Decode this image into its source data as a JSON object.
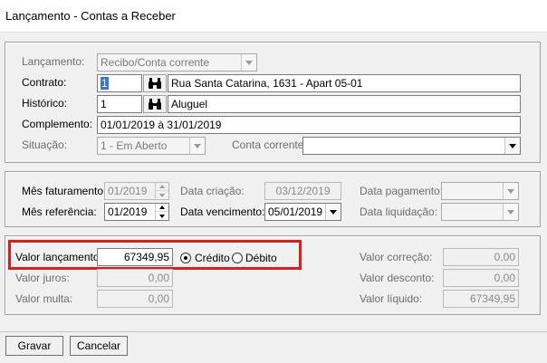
{
  "window": {
    "title": "Lançamento - Contas a Receber"
  },
  "section_main": {
    "lancamento": {
      "label": "Lançamento:",
      "value": "Recibo/Conta corrente"
    },
    "contrato": {
      "label": "Contrato:",
      "code": "1",
      "description": "Rua Santa Catarina, 1631 - Apart 05-01"
    },
    "historico": {
      "label": "Histórico:",
      "code": "1",
      "description": "Aluguel"
    },
    "complemento": {
      "label": "Complemento:",
      "value": "01/01/2019 à 31/01/2019"
    },
    "situacao": {
      "label": "Situação:",
      "value": "1 - Em Aberto"
    },
    "conta_corrente": {
      "label": "Conta corrente:",
      "value": ""
    }
  },
  "section_dates": {
    "mes_faturamento": {
      "label": "Mês faturamento:",
      "value": "01/2019"
    },
    "mes_referencia": {
      "label": "Mês referência:",
      "value": "01/2019"
    },
    "data_criacao": {
      "label": "Data criação:",
      "value": "03/12/2019"
    },
    "data_vencimento": {
      "label": "Data vencimento:",
      "value": "05/01/2019"
    },
    "data_pagamento": {
      "label": "Data pagamento:",
      "value": ""
    },
    "data_liquidacao": {
      "label": "Data liquidação:",
      "value": ""
    }
  },
  "section_values": {
    "valor_lancamento": {
      "label": "Valor lançamento:",
      "value": "67349,95"
    },
    "credito_label": "Crédito",
    "debito_label": "Débito",
    "selected_type": "credito",
    "valor_juros": {
      "label": "Valor juros:",
      "value": "0,00"
    },
    "valor_multa": {
      "label": "Valor multa:",
      "value": "0,00"
    },
    "valor_correcao": {
      "label": "Valor correção:",
      "value": "0,00"
    },
    "valor_desconto": {
      "label": "Valor desconto:",
      "value": "0,00"
    },
    "valor_liquido": {
      "label": "Valor líquido:",
      "value": "67349,95"
    }
  },
  "buttons": {
    "save": "Gravar",
    "cancel": "Cancelar"
  },
  "colors": {
    "highlight": "#d42020",
    "selection": "#3875d7"
  },
  "icons": {
    "search": "binoculars-icon"
  }
}
